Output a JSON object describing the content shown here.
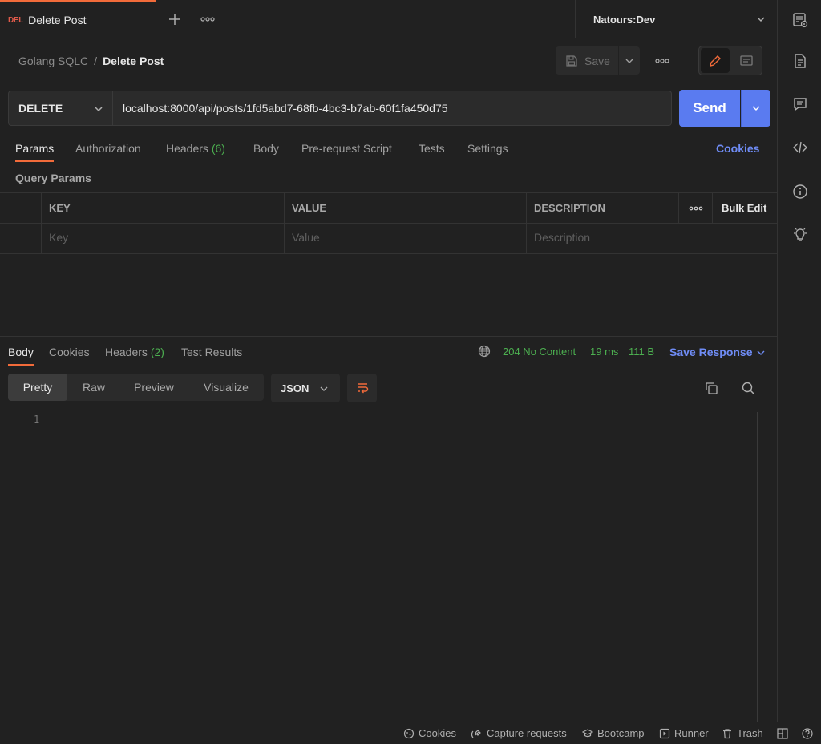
{
  "tab": {
    "method": "DEL",
    "title": "Delete Post"
  },
  "environment": {
    "name": "Natours:Dev"
  },
  "breadcrumb": {
    "collection": "Golang SQLC",
    "separator": "/",
    "request": "Delete Post"
  },
  "toolbar": {
    "save_label": "Save"
  },
  "request": {
    "method": "DELETE",
    "url": "localhost:8000/api/posts/1fd5abd7-68fb-4bc3-b7ab-60f1fa450d75",
    "send_label": "Send"
  },
  "request_tabs": {
    "params": "Params",
    "authorization": "Authorization",
    "headers": "Headers",
    "headers_count": "(6)",
    "body": "Body",
    "pre_request": "Pre-request Script",
    "tests": "Tests",
    "settings": "Settings",
    "cookies": "Cookies"
  },
  "query_params": {
    "title": "Query Params",
    "columns": {
      "key": "KEY",
      "value": "VALUE",
      "description": "DESCRIPTION"
    },
    "bulk_edit": "Bulk Edit",
    "placeholders": {
      "key": "Key",
      "value": "Value",
      "description": "Description"
    }
  },
  "response_tabs": {
    "body": "Body",
    "cookies": "Cookies",
    "headers": "Headers",
    "headers_count": "(2)",
    "test_results": "Test Results"
  },
  "response_status": {
    "status": "204 No Content",
    "time": "19 ms",
    "size": "111 B",
    "save_response": "Save Response"
  },
  "format": {
    "pretty": "Pretty",
    "raw": "Raw",
    "preview": "Preview",
    "visualize": "Visualize",
    "language": "JSON"
  },
  "editor": {
    "line_numbers": [
      "1"
    ]
  },
  "statusbar": {
    "cookies": "Cookies",
    "capture": "Capture requests",
    "bootcamp": "Bootcamp",
    "runner": "Runner",
    "trash": "Trash"
  },
  "colors": {
    "accent": "#f26b3a",
    "primary": "#5a7bf0",
    "success": "#4caf50",
    "link": "#6f8cf5",
    "delete_method": "#e05a4a"
  }
}
